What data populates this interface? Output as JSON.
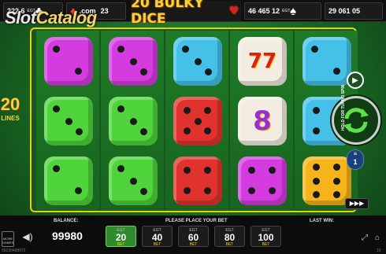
{
  "game": {
    "title": "20 BULKY DICE"
  },
  "watermark": {
    "part1": "Slot",
    "part2": "Catalog"
  },
  "jackpots": [
    {
      "value": "222 6",
      "suit": "♣",
      "suit_color": "#ffffff"
    },
    {
      "value": ".com",
      "suit": "♦",
      "suit_color": "#ff3b30"
    },
    {
      "value": "23",
      "suit": "",
      "suit_color": "#ffffff"
    },
    {
      "value": "46 465 12",
      "suit": "♠",
      "suit_color": "#ffffff"
    },
    {
      "value": "29 061 05",
      "suit": "",
      "suit_color": "#ffffff"
    }
  ],
  "jackpot_label": "EGT",
  "lines_badge": {
    "number": "20",
    "label": "LINES"
  },
  "reels": [
    [
      {
        "color": "magenta",
        "pips": 2
      },
      {
        "color": "green",
        "pips": 3
      },
      {
        "color": "green",
        "pips": 2
      }
    ],
    [
      {
        "color": "magenta",
        "pips": 3
      },
      {
        "color": "green",
        "pips": 3
      },
      {
        "color": "green",
        "pips": 3
      }
    ],
    [
      {
        "color": "blue",
        "pips": 3
      },
      {
        "color": "red",
        "pips": 5
      },
      {
        "color": "red",
        "pips": 4
      }
    ],
    [
      {
        "color": "white",
        "symbol": "77"
      },
      {
        "color": "white",
        "symbol": "8"
      },
      {
        "color": "magenta",
        "pips": 4
      }
    ],
    [
      {
        "color": "blue",
        "pips": 2
      },
      {
        "color": "blue",
        "pips": 4
      },
      {
        "color": "yellow",
        "pips": 6
      }
    ]
  ],
  "controls": {
    "turbo_label": "HOLD FOR TURBO SPIN",
    "autoplay_count": "1"
  },
  "bottom": {
    "balance_label": "BALANCE:",
    "balance_value": "99980",
    "place_bet_label": "PLEASE PLACE YOUR BET",
    "last_win_label": "LAST WIN:",
    "bets": [
      {
        "egt": "EGT",
        "value": "20",
        "bet": "BET",
        "active": true
      },
      {
        "egt": "EGT",
        "value": "40",
        "bet": "BET",
        "active": false
      },
      {
        "egt": "EGT",
        "value": "60",
        "bet": "BET",
        "active": false
      },
      {
        "egt": "EGT",
        "value": "80",
        "bet": "BET",
        "active": false
      },
      {
        "egt": "EGT",
        "value": "100",
        "bet": "BET",
        "active": false
      }
    ],
    "more_games_label": "MORE GAMES",
    "session_id": "09230488972",
    "version": "10"
  },
  "colors": {
    "magenta": "#d43ce0",
    "green": "#4fd43b",
    "blue": "#45c0e8",
    "red": "#e2322e",
    "yellow": "#f4b41a",
    "white": "#f3ece0",
    "frame": "#e6d20c",
    "accent": "#f8d23a"
  },
  "icons": [
    "heart-icon",
    "spade-icon",
    "club-icon",
    "diamond-icon",
    "speaker-icon",
    "fullscreen-icon",
    "play-icon",
    "spin-icon",
    "autoplay-icon",
    "fast-forward-icon",
    "home-icon"
  ]
}
